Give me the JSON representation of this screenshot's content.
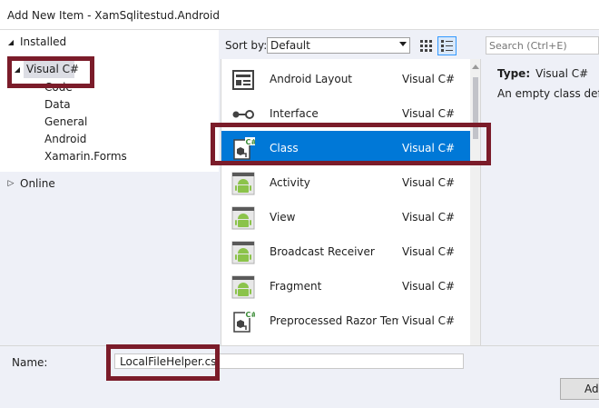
{
  "window": {
    "title": "Add New Item - XamSqlitestud.Android"
  },
  "tree": {
    "installed_label": "Installed",
    "visual_csharp_label": "Visual C#",
    "children": [
      "Code",
      "Data",
      "General",
      "Android",
      "Xamarin.Forms"
    ],
    "online_label": "Online"
  },
  "toolbar": {
    "sort_label": "Sort by:",
    "sort_value": "Default",
    "search_placeholder": "Search (Ctrl+E)"
  },
  "templates": [
    {
      "name": "Android Layout",
      "lang": "Visual C#",
      "icon": "layout-icon"
    },
    {
      "name": "Interface",
      "lang": "Visual C#",
      "icon": "interface-icon"
    },
    {
      "name": "Class",
      "lang": "Visual C#",
      "icon": "csharp-class-icon",
      "selected": true
    },
    {
      "name": "Activity",
      "lang": "Visual C#",
      "icon": "android-icon"
    },
    {
      "name": "View",
      "lang": "Visual C#",
      "icon": "android-icon"
    },
    {
      "name": "Broadcast Receiver",
      "lang": "Visual C#",
      "icon": "android-icon"
    },
    {
      "name": "Fragment",
      "lang": "Visual C#",
      "icon": "android-icon"
    },
    {
      "name": "Preprocessed Razor Temp...",
      "lang": "Visual C#",
      "icon": "csharp-file-icon"
    }
  ],
  "description": {
    "type_label": "Type:",
    "type_value": "Visual C#",
    "text": "An empty class defin"
  },
  "footer": {
    "name_label": "Name:",
    "name_value": "LocalFileHelper.cs",
    "add_label": "Add"
  },
  "colors": {
    "selection": "#0078d7",
    "highlight": "#7b1c2a",
    "android_green": "#8bc34a"
  }
}
